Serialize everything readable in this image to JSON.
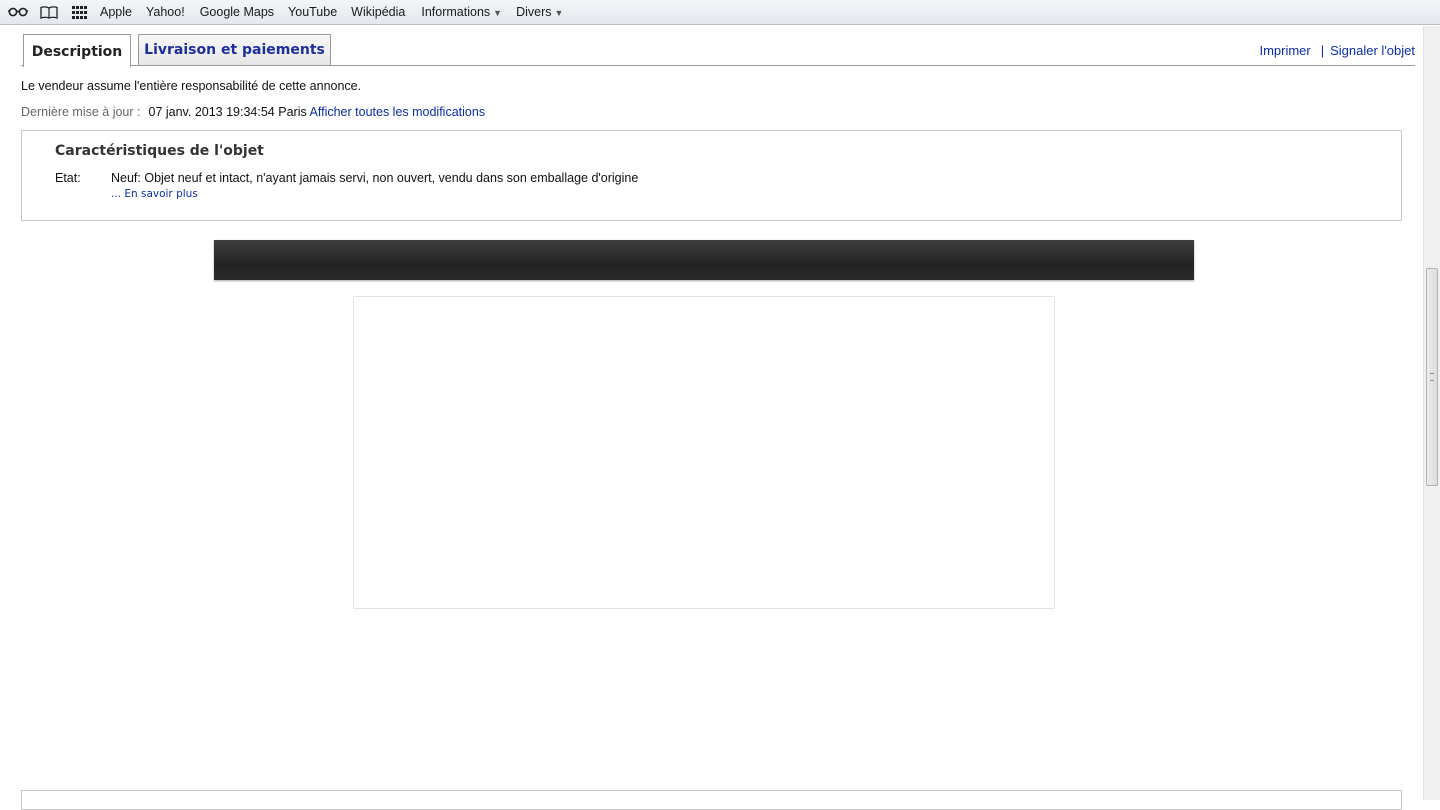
{
  "bookmarks": {
    "items": [
      {
        "label": "Apple"
      },
      {
        "label": "Yahoo!"
      },
      {
        "label": "Google Maps"
      },
      {
        "label": "YouTube"
      },
      {
        "label": "Wikipédia"
      },
      {
        "label": "Informations",
        "dropdown": true
      },
      {
        "label": "Divers",
        "dropdown": true
      }
    ],
    "icons": [
      "reading-list-icon",
      "bookmarks-book-icon",
      "top-sites-grid-icon"
    ]
  },
  "tabs": [
    {
      "label": "Description",
      "active": true
    },
    {
      "label": "Livraison et paiements",
      "active": false
    }
  ],
  "top_links": {
    "print": "Imprimer",
    "separator": "|",
    "report": "Signaler l'objet"
  },
  "listing": {
    "responsibility": "Le vendeur assume l'entière responsabilité de cette annonce.",
    "updated_label": "Dernière mise à jour :",
    "updated_date": "07 janv. 2013 19:34:54 Paris",
    "show_changes": "Afficher toutes les modifications"
  },
  "characteristics": {
    "title": "Caractéristiques de l'objet",
    "condition_label": "Etat:",
    "condition_value": "Neuf: Objet neuf et intact, n'ayant jamais servi, non ouvert, vendu dans son emballage d'origine",
    "more": "... En savoir plus"
  },
  "colors": {
    "link": "#0a2da6",
    "banner": "#2a2a2a"
  }
}
